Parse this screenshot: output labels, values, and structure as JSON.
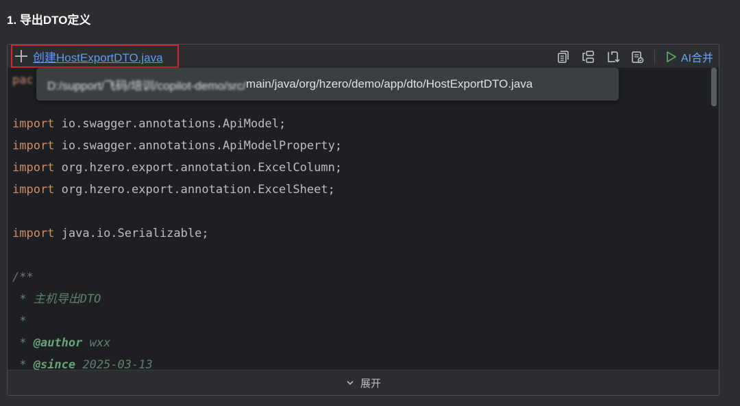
{
  "section": {
    "title": "1. 导出DTO定义"
  },
  "header": {
    "create_link": "创建HostExportDTO.java",
    "ai_merge_label": "AI合并",
    "icons": [
      "copy-icon",
      "diff-icon",
      "insert-icon",
      "apply-icon",
      "run-icon"
    ]
  },
  "tooltip": {
    "path_hidden": "D:/support/飞码/培训/copilot-demo/src/",
    "path_visible": "main/java/org/hzero/demo/app/dto/HostExportDTO.java"
  },
  "code": {
    "pac_fragment": "pac",
    "lines": [
      {
        "kw": "import",
        "rest": " io.swagger.annotations.ApiModel;"
      },
      {
        "kw": "import",
        "rest": " io.swagger.annotations.ApiModelProperty;"
      },
      {
        "kw": "import",
        "rest": " org.hzero.export.annotation.ExcelColumn;"
      },
      {
        "kw": "import",
        "rest": " org.hzero.export.annotation.ExcelSheet;"
      },
      {
        "kw": "import",
        "rest": " java.io.Serializable;"
      }
    ],
    "doc_open": "/**",
    "doc_desc": " * 主机导出DTO",
    "doc_star": " *",
    "doc_author_prefix": " * ",
    "doc_author_tag": "@author",
    "doc_author_val": " wxx",
    "doc_since_prefix": " * ",
    "doc_since_tag": "@since",
    "doc_since_val": " 2025-03-13"
  },
  "footer": {
    "expand_label": "展开"
  },
  "colors": {
    "highlight_border": "#d8232a",
    "link": "#5d9cf5",
    "keyword": "#cf8e6d"
  }
}
